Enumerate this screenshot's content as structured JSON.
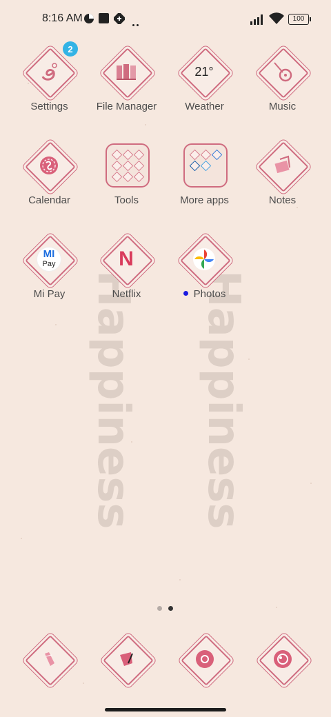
{
  "status_bar": {
    "time": "8:16 AM",
    "battery": "100",
    "icons": [
      "data-saver-icon",
      "square-icon",
      "sim-icon",
      "more-icon",
      "signal-icon",
      "wifi-icon",
      "battery-icon"
    ]
  },
  "watermark": {
    "text": "Happiness"
  },
  "apps": [
    {
      "label": "Settings",
      "icon": "settings-icon",
      "badge": "2"
    },
    {
      "label": "File Manager",
      "icon": "file-manager-icon"
    },
    {
      "label": "Weather",
      "icon": "weather-icon",
      "temp": "21°"
    },
    {
      "label": "Music",
      "icon": "music-icon"
    },
    {
      "label": "Calendar",
      "icon": "calendar-icon"
    },
    {
      "label": "Tools",
      "icon": "tools-folder-icon"
    },
    {
      "label": "More apps",
      "icon": "more-apps-folder-icon"
    },
    {
      "label": "Notes",
      "icon": "notes-icon"
    },
    {
      "label": "Mi Pay",
      "icon": "mi-pay-icon",
      "logo_text": "MI",
      "logo_sub": "Pay"
    },
    {
      "label": "Netflix",
      "icon": "netflix-icon",
      "logo_text": "N"
    },
    {
      "label": "Photos",
      "icon": "photos-icon",
      "new": true
    }
  ],
  "dock": [
    {
      "icon": "phone-icon"
    },
    {
      "icon": "messages-icon"
    },
    {
      "icon": "chrome-icon"
    },
    {
      "icon": "camera-icon"
    }
  ],
  "pages": {
    "count": 2,
    "current": 2
  },
  "colors": {
    "background": "#f6e8df",
    "accent": "#cf6b7f",
    "badge": "#33b3e5",
    "new_dot": "#1a1ae0"
  }
}
